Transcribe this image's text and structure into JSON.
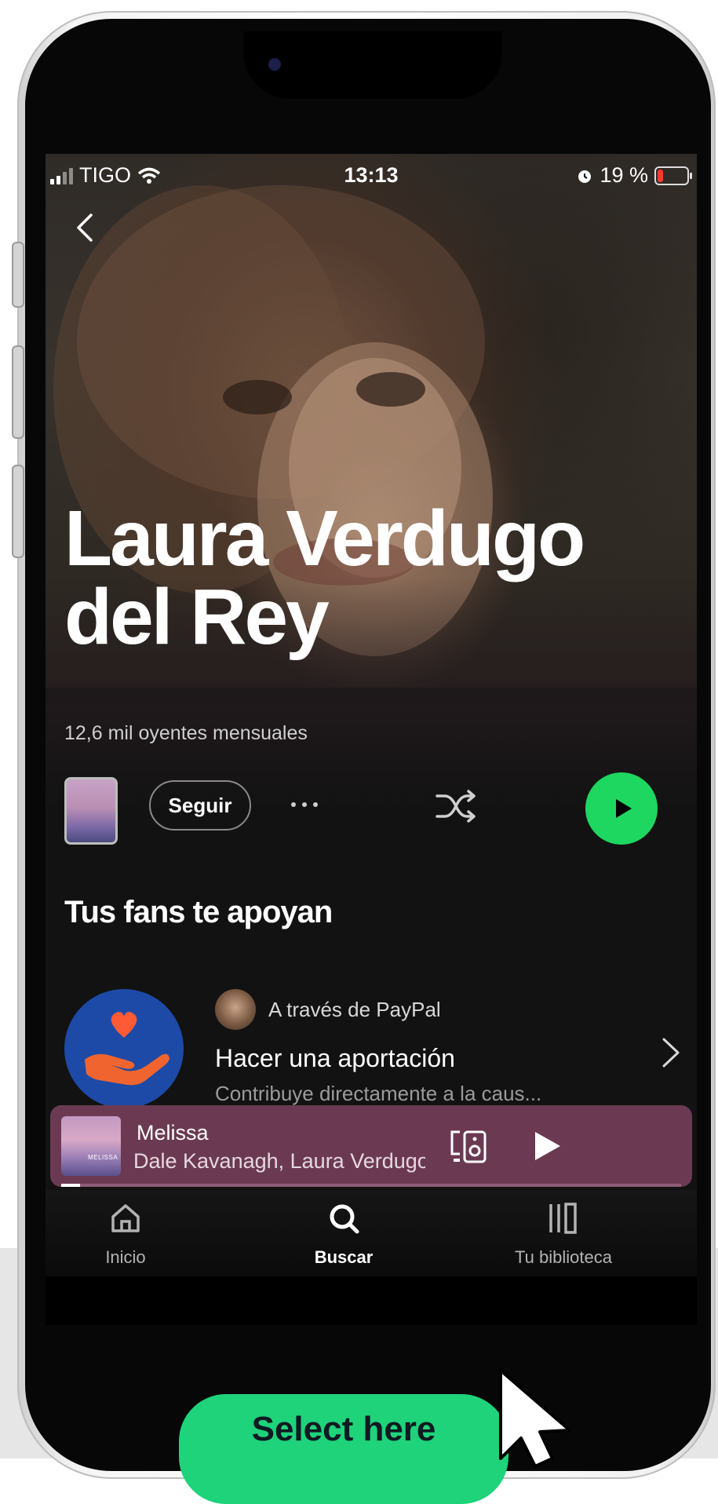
{
  "status_bar": {
    "carrier": "TIGO",
    "time": "13:13",
    "battery": "19 %",
    "battery_level": 0.19,
    "battery_color": "#ff3b30"
  },
  "artist": {
    "name": "Laura Verdugo del Rey",
    "listeners": "12,6 mil oyentes mensuales"
  },
  "controls": {
    "follow_label": "Seguir",
    "more_icon": "more-horizontal-icon",
    "shuffle_icon": "shuffle-icon",
    "play_icon": "play-icon",
    "accent_color": "#1ed760"
  },
  "fans_section": {
    "title": "Tus fans te apoyan",
    "via": "A través de PayPal",
    "action_title": "Hacer una aportación",
    "action_subtitle": "Contribuye directamente a la caus...",
    "logo_icon": "heart-hand-icon"
  },
  "now_playing": {
    "title": "Melissa",
    "artists": "Dale Kavanagh, Laura Verdugo del Rey",
    "cover_text": "MELISSA",
    "device_icon": "speaker-device-icon",
    "play_icon": "play-icon",
    "progress": 0.03,
    "background_color": "#6b3a52"
  },
  "tabs": [
    {
      "label": "Inicio",
      "icon": "home-icon",
      "active": false
    },
    {
      "label": "Buscar",
      "icon": "search-icon",
      "active": true
    },
    {
      "label": "Tu biblioteca",
      "icon": "library-icon",
      "active": false
    }
  ],
  "callout": {
    "label": "Select here",
    "color": "#1ed37a"
  }
}
